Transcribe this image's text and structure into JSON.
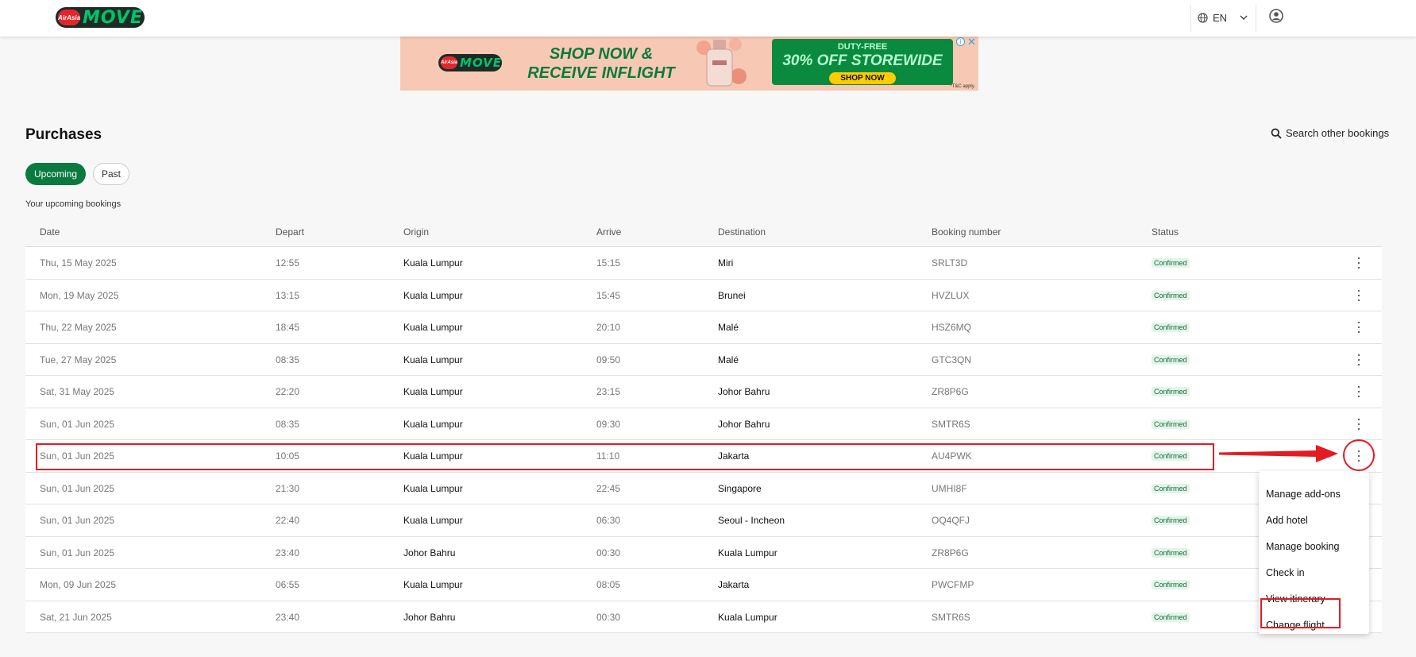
{
  "header": {
    "logo_badge": "AirAsia",
    "logo_text": "MOVE",
    "language": "EN",
    "icons": {
      "language": "globe-icon",
      "dropdown": "chevron-down-icon",
      "account": "user-circle-icon"
    }
  },
  "banner": {
    "logo_badge": "AirAsia",
    "logo_text": "MOVE",
    "headline_1": "SHOP NOW &",
    "headline_2": "RECEIVE INFLIGHT",
    "duty_free": "DUTY-FREE",
    "offer": "30% OFF STOREWIDE",
    "cta": "SHOP NOW",
    "terms": "*T&C apply.",
    "info_glyph": "i",
    "close_glyph": "✕"
  },
  "page": {
    "title": "Purchases",
    "search_label": "Search other bookings",
    "tabs": [
      {
        "label": "Upcoming",
        "active": true
      },
      {
        "label": "Past",
        "active": false
      }
    ],
    "section_label": "Your upcoming bookings"
  },
  "table": {
    "columns": [
      "Date",
      "Depart",
      "Origin",
      "Arrive",
      "Destination",
      "Booking number",
      "Status"
    ],
    "rows": [
      {
        "date": "Thu, 15 May 2025",
        "depart": "12:55",
        "origin": "Kuala Lumpur",
        "arrive": "15:15",
        "destination": "Miri",
        "booking": "SRLT3D",
        "status": "Confirmed"
      },
      {
        "date": "Mon, 19 May 2025",
        "depart": "13:15",
        "origin": "Kuala Lumpur",
        "arrive": "15:45",
        "destination": "Brunei",
        "booking": "HVZLUX",
        "status": "Confirmed"
      },
      {
        "date": "Thu, 22 May 2025",
        "depart": "18:45",
        "origin": "Kuala Lumpur",
        "arrive": "20:10",
        "destination": "Malé",
        "booking": "HSZ6MQ",
        "status": "Confirmed"
      },
      {
        "date": "Tue, 27 May 2025",
        "depart": "08:35",
        "origin": "Kuala Lumpur",
        "arrive": "09:50",
        "destination": "Malé",
        "booking": "GTC3QN",
        "status": "Confirmed"
      },
      {
        "date": "Sat, 31 May 2025",
        "depart": "22:20",
        "origin": "Kuala Lumpur",
        "arrive": "23:15",
        "destination": "Johor Bahru",
        "booking": "ZR8P6G",
        "status": "Confirmed"
      },
      {
        "date": "Sun, 01 Jun 2025",
        "depart": "08:35",
        "origin": "Kuala Lumpur",
        "arrive": "09:30",
        "destination": "Johor Bahru",
        "booking": "SMTR6S",
        "status": "Confirmed"
      },
      {
        "date": "Sun, 01 Jun 2025",
        "depart": "10:05",
        "origin": "Kuala Lumpur",
        "arrive": "11:10",
        "destination": "Jakarta",
        "booking": "AU4PWK",
        "status": "Confirmed"
      },
      {
        "date": "Sun, 01 Jun 2025",
        "depart": "21:30",
        "origin": "Kuala Lumpur",
        "arrive": "22:45",
        "destination": "Singapore",
        "booking": "UMHI8F",
        "status": "Confirmed"
      },
      {
        "date": "Sun, 01 Jun 2025",
        "depart": "22:40",
        "origin": "Kuala Lumpur",
        "arrive": "06:30",
        "destination": "Seoul - Incheon",
        "booking": "OQ4QFJ",
        "status": "Confirmed"
      },
      {
        "date": "Sun, 01 Jun 2025",
        "depart": "23:40",
        "origin": "Johor Bahru",
        "arrive": "00:30",
        "destination": "Kuala Lumpur",
        "booking": "ZR8P6G",
        "status": "Confirmed"
      },
      {
        "date": "Mon, 09 Jun 2025",
        "depart": "06:55",
        "origin": "Kuala Lumpur",
        "arrive": "08:05",
        "destination": "Jakarta",
        "booking": "PWCFMP",
        "status": "Confirmed"
      },
      {
        "date": "Sat, 21 Jun 2025",
        "depart": "23:40",
        "origin": "Johor Bahru",
        "arrive": "00:30",
        "destination": "Kuala Lumpur",
        "booking": "SMTR6S",
        "status": "Confirmed"
      }
    ],
    "menu_open_row": 6,
    "kebab_rows": [
      0,
      1,
      2,
      3,
      4,
      5,
      6
    ]
  },
  "menu": {
    "items": [
      "Manage add-ons",
      "Add hotel",
      "Manage booking",
      "Check in",
      "View itinerary",
      "Change flight"
    ]
  },
  "colors": {
    "brand_green": "#0b7a3f",
    "badge_bg": "#e4f4e9",
    "badge_text": "#146b3a",
    "annotation_red": "#e31b23"
  }
}
